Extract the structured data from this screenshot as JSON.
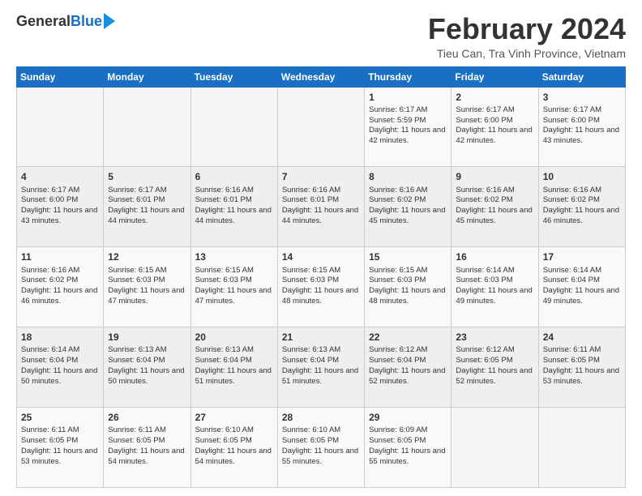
{
  "header": {
    "logo_general": "General",
    "logo_blue": "Blue",
    "month_title": "February 2024",
    "location": "Tieu Can, Tra Vinh Province, Vietnam"
  },
  "days_of_week": [
    "Sunday",
    "Monday",
    "Tuesday",
    "Wednesday",
    "Thursday",
    "Friday",
    "Saturday"
  ],
  "weeks": [
    [
      {
        "day": "",
        "sunrise": "",
        "sunset": "",
        "daylight": ""
      },
      {
        "day": "",
        "sunrise": "",
        "sunset": "",
        "daylight": ""
      },
      {
        "day": "",
        "sunrise": "",
        "sunset": "",
        "daylight": ""
      },
      {
        "day": "",
        "sunrise": "",
        "sunset": "",
        "daylight": ""
      },
      {
        "day": "1",
        "sunrise": "Sunrise: 6:17 AM",
        "sunset": "Sunset: 5:59 PM",
        "daylight": "Daylight: 11 hours and 42 minutes."
      },
      {
        "day": "2",
        "sunrise": "Sunrise: 6:17 AM",
        "sunset": "Sunset: 6:00 PM",
        "daylight": "Daylight: 11 hours and 42 minutes."
      },
      {
        "day": "3",
        "sunrise": "Sunrise: 6:17 AM",
        "sunset": "Sunset: 6:00 PM",
        "daylight": "Daylight: 11 hours and 43 minutes."
      }
    ],
    [
      {
        "day": "4",
        "sunrise": "Sunrise: 6:17 AM",
        "sunset": "Sunset: 6:00 PM",
        "daylight": "Daylight: 11 hours and 43 minutes."
      },
      {
        "day": "5",
        "sunrise": "Sunrise: 6:17 AM",
        "sunset": "Sunset: 6:01 PM",
        "daylight": "Daylight: 11 hours and 44 minutes."
      },
      {
        "day": "6",
        "sunrise": "Sunrise: 6:16 AM",
        "sunset": "Sunset: 6:01 PM",
        "daylight": "Daylight: 11 hours and 44 minutes."
      },
      {
        "day": "7",
        "sunrise": "Sunrise: 6:16 AM",
        "sunset": "Sunset: 6:01 PM",
        "daylight": "Daylight: 11 hours and 44 minutes."
      },
      {
        "day": "8",
        "sunrise": "Sunrise: 6:16 AM",
        "sunset": "Sunset: 6:02 PM",
        "daylight": "Daylight: 11 hours and 45 minutes."
      },
      {
        "day": "9",
        "sunrise": "Sunrise: 6:16 AM",
        "sunset": "Sunset: 6:02 PM",
        "daylight": "Daylight: 11 hours and 45 minutes."
      },
      {
        "day": "10",
        "sunrise": "Sunrise: 6:16 AM",
        "sunset": "Sunset: 6:02 PM",
        "daylight": "Daylight: 11 hours and 46 minutes."
      }
    ],
    [
      {
        "day": "11",
        "sunrise": "Sunrise: 6:16 AM",
        "sunset": "Sunset: 6:02 PM",
        "daylight": "Daylight: 11 hours and 46 minutes."
      },
      {
        "day": "12",
        "sunrise": "Sunrise: 6:15 AM",
        "sunset": "Sunset: 6:03 PM",
        "daylight": "Daylight: 11 hours and 47 minutes."
      },
      {
        "day": "13",
        "sunrise": "Sunrise: 6:15 AM",
        "sunset": "Sunset: 6:03 PM",
        "daylight": "Daylight: 11 hours and 47 minutes."
      },
      {
        "day": "14",
        "sunrise": "Sunrise: 6:15 AM",
        "sunset": "Sunset: 6:03 PM",
        "daylight": "Daylight: 11 hours and 48 minutes."
      },
      {
        "day": "15",
        "sunrise": "Sunrise: 6:15 AM",
        "sunset": "Sunset: 6:03 PM",
        "daylight": "Daylight: 11 hours and 48 minutes."
      },
      {
        "day": "16",
        "sunrise": "Sunrise: 6:14 AM",
        "sunset": "Sunset: 6:03 PM",
        "daylight": "Daylight: 11 hours and 49 minutes."
      },
      {
        "day": "17",
        "sunrise": "Sunrise: 6:14 AM",
        "sunset": "Sunset: 6:04 PM",
        "daylight": "Daylight: 11 hours and 49 minutes."
      }
    ],
    [
      {
        "day": "18",
        "sunrise": "Sunrise: 6:14 AM",
        "sunset": "Sunset: 6:04 PM",
        "daylight": "Daylight: 11 hours and 50 minutes."
      },
      {
        "day": "19",
        "sunrise": "Sunrise: 6:13 AM",
        "sunset": "Sunset: 6:04 PM",
        "daylight": "Daylight: 11 hours and 50 minutes."
      },
      {
        "day": "20",
        "sunrise": "Sunrise: 6:13 AM",
        "sunset": "Sunset: 6:04 PM",
        "daylight": "Daylight: 11 hours and 51 minutes."
      },
      {
        "day": "21",
        "sunrise": "Sunrise: 6:13 AM",
        "sunset": "Sunset: 6:04 PM",
        "daylight": "Daylight: 11 hours and 51 minutes."
      },
      {
        "day": "22",
        "sunrise": "Sunrise: 6:12 AM",
        "sunset": "Sunset: 6:04 PM",
        "daylight": "Daylight: 11 hours and 52 minutes."
      },
      {
        "day": "23",
        "sunrise": "Sunrise: 6:12 AM",
        "sunset": "Sunset: 6:05 PM",
        "daylight": "Daylight: 11 hours and 52 minutes."
      },
      {
        "day": "24",
        "sunrise": "Sunrise: 6:11 AM",
        "sunset": "Sunset: 6:05 PM",
        "daylight": "Daylight: 11 hours and 53 minutes."
      }
    ],
    [
      {
        "day": "25",
        "sunrise": "Sunrise: 6:11 AM",
        "sunset": "Sunset: 6:05 PM",
        "daylight": "Daylight: 11 hours and 53 minutes."
      },
      {
        "day": "26",
        "sunrise": "Sunrise: 6:11 AM",
        "sunset": "Sunset: 6:05 PM",
        "daylight": "Daylight: 11 hours and 54 minutes."
      },
      {
        "day": "27",
        "sunrise": "Sunrise: 6:10 AM",
        "sunset": "Sunset: 6:05 PM",
        "daylight": "Daylight: 11 hours and 54 minutes."
      },
      {
        "day": "28",
        "sunrise": "Sunrise: 6:10 AM",
        "sunset": "Sunset: 6:05 PM",
        "daylight": "Daylight: 11 hours and 55 minutes."
      },
      {
        "day": "29",
        "sunrise": "Sunrise: 6:09 AM",
        "sunset": "Sunset: 6:05 PM",
        "daylight": "Daylight: 11 hours and 55 minutes."
      },
      {
        "day": "",
        "sunrise": "",
        "sunset": "",
        "daylight": ""
      },
      {
        "day": "",
        "sunrise": "",
        "sunset": "",
        "daylight": ""
      }
    ]
  ]
}
